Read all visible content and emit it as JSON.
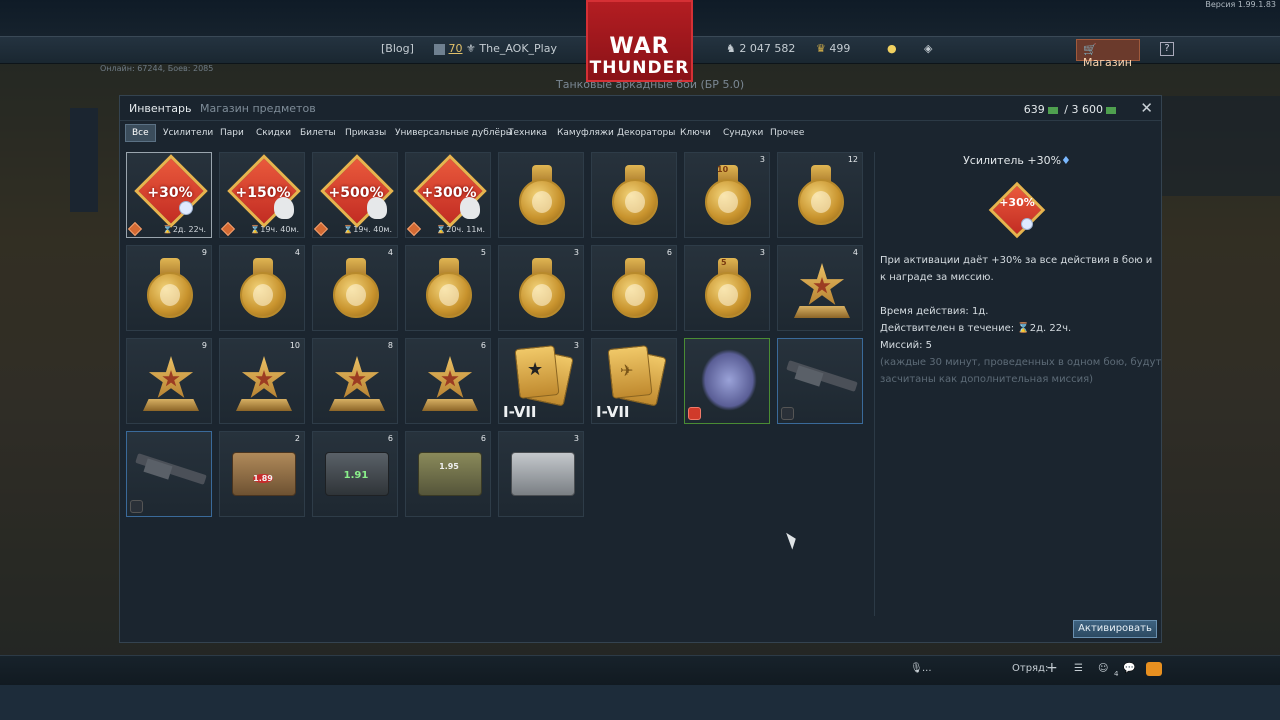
{
  "top": {
    "version": "Версия 1.99.1.83",
    "blog": "[Blog]",
    "level": "70",
    "player": "The_AOK_Play",
    "silver": "2 047 582",
    "gold": "499",
    "shop": "Магазин",
    "help": "?",
    "mode": "Танковые аркадные бои (БР 5.0)",
    "online": "Онлайн: 67244, Боев: 2085"
  },
  "logo": {
    "line1": "WAR",
    "line2": "THUNDER"
  },
  "panel": {
    "tab_inventory": "Инвентарь",
    "tab_shop": "Магазин предметов",
    "gold_have": "639",
    "gold_sep": "/",
    "gold_need": "3 600",
    "close": "✕",
    "categories": [
      "Все",
      "Усилители",
      "Пари",
      "Скидки",
      "Билеты",
      "Приказы",
      "Универсальные дублёры",
      "Техника",
      "Камуфляжи",
      "Декораторы",
      "Ключи",
      "Сундуки",
      "Прочее"
    ]
  },
  "items": {
    "b30": {
      "text": "+30%",
      "timer": "⌛2д. 22ч."
    },
    "b150": {
      "text": "+150%",
      "timer": "⌛19ч. 40м."
    },
    "b500": {
      "text": "+500%",
      "timer": "⌛19ч. 40м."
    },
    "b300": {
      "text": "+300%",
      "timer": "⌛20ч. 11м."
    },
    "counts": {
      "r1c7": "3",
      "r1c8": "12",
      "r2c1": "9",
      "r2c2": "4",
      "r2c3": "4",
      "r2c4": "5",
      "r2c5": "3",
      "r2c6": "6",
      "r2c7": "3",
      "r2c8": "4",
      "r3c1": "9",
      "r3c2": "10",
      "r3c3": "8",
      "r3c4": "6",
      "r3c5": "3",
      "r4c2": "2",
      "r4c3": "6",
      "r4c4": "6",
      "r4c5": "3"
    },
    "roman1": "I-VII",
    "roman2": "I-VII",
    "medal_label_1": "10",
    "medal_label_2": "5",
    "crate_labels": [
      "1.89",
      "1.91",
      "1.95"
    ]
  },
  "details": {
    "title": "Усилитель +30%",
    "icon_text": "+30%",
    "line1": "При активации даёт +30% за все действия в бою и",
    "line2": "к награде за миссию.",
    "time": "Время действия: 1д.",
    "valid": "Действителен в течение: ⌛2д. 22ч.",
    "missions": "Миссий: 5",
    "note1": "(каждые 30 минут, проведенных в одном бою, будут",
    "note2": "засчитаны как дополнительная миссия)",
    "activate": "Активировать"
  },
  "bottom": {
    "mic": "...",
    "squad": "Отряд:",
    "plus": "+",
    "friends_count": "4"
  },
  "colors": {
    "accent": "#3e6280",
    "logo": "#b31d22",
    "gold_icon": "#4fa04f",
    "mail": "#e89020"
  }
}
